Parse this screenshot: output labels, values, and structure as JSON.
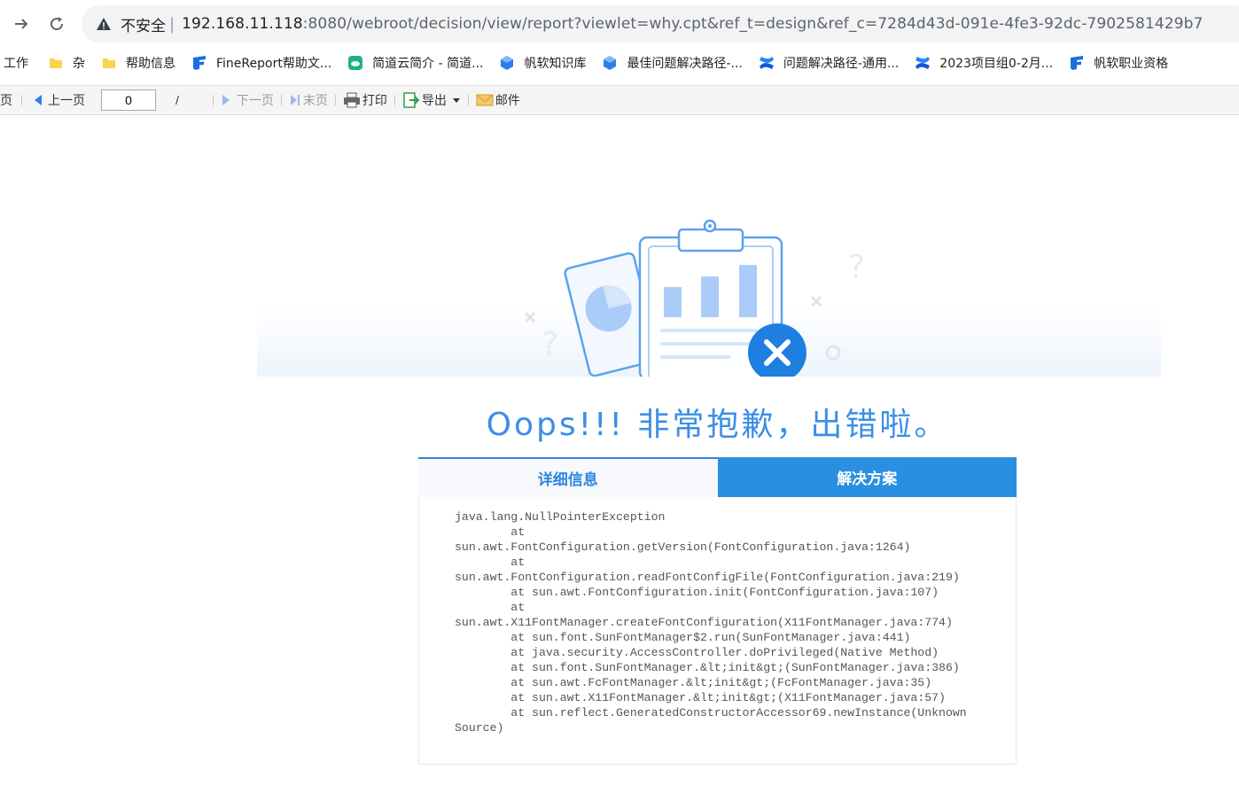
{
  "browser": {
    "security_label": "不安全",
    "url_host": "192.168.11.118",
    "url_rest": ":8080/webroot/decision/view/report?viewlet=why.cpt&ref_t=design&ref_c=7284d43d-091e-4fe3-92dc-7902581429b7"
  },
  "bookmarks": [
    {
      "label": "工作",
      "icon": "none"
    },
    {
      "label": "杂",
      "icon": "folder-icon"
    },
    {
      "label": "帮助信息",
      "icon": "folder-icon"
    },
    {
      "label": "FineReport帮助文...",
      "icon": "finereport-icon"
    },
    {
      "label": "简道云简介 - 简道...",
      "icon": "jiandaoyun-icon"
    },
    {
      "label": "帆软知识库",
      "icon": "cube-icon"
    },
    {
      "label": "最佳问题解决路径-...",
      "icon": "cube-icon"
    },
    {
      "label": "问题解决路径-通用...",
      "icon": "confluence-icon"
    },
    {
      "label": "2023项目组0-2月...",
      "icon": "confluence-icon"
    },
    {
      "label": "帆软职业资格",
      "icon": "finereport-icon"
    }
  ],
  "toolbar": {
    "first_page_partial": "页",
    "prev_label": "上一页",
    "page_value": "0",
    "page_sep": "/",
    "next_label": "下一页",
    "last_label": "末页",
    "print_label": "打印",
    "export_label": "导出",
    "mail_label": "邮件"
  },
  "error": {
    "headline": "Oops!!! 非常抱歉，出错啦。",
    "tab_detail": "详细信息",
    "tab_solution": "解决方案",
    "stack_trace": "java.lang.NullPointerException\n        at\nsun.awt.FontConfiguration.getVersion(FontConfiguration.java:1264)\n        at\nsun.awt.FontConfiguration.readFontConfigFile(FontConfiguration.java:219)\n        at sun.awt.FontConfiguration.init(FontConfiguration.java:107)\n        at\nsun.awt.X11FontManager.createFontConfiguration(X11FontManager.java:774)\n        at sun.font.SunFontManager$2.run(SunFontManager.java:441)\n        at java.security.AccessController.doPrivileged(Native Method)\n        at sun.font.SunFontManager.&lt;init&gt;(SunFontManager.java:386)\n        at sun.awt.FcFontManager.&lt;init&gt;(FcFontManager.java:35)\n        at sun.awt.X11FontManager.&lt;init&gt;(X11FontManager.java:57)\n        at sun.reflect.GeneratedConstructorAccessor69.newInstance(Unknown\nSource)"
  },
  "colors": {
    "accent": "#2a8fe0",
    "headline": "#3c8ee6",
    "error_red": "#1f7fe0"
  }
}
